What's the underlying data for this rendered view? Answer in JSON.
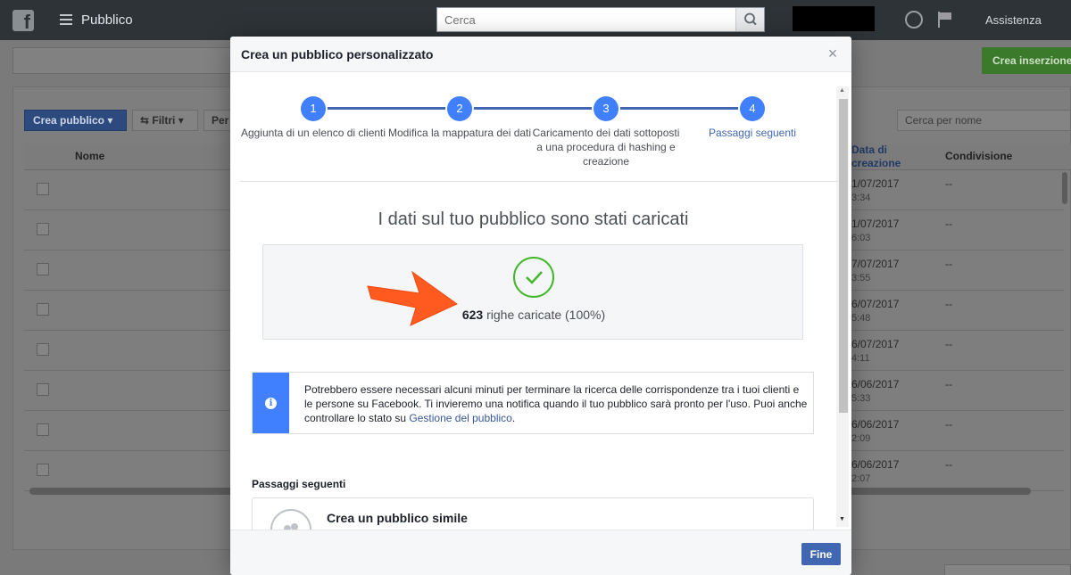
{
  "topbar": {
    "logo_letter": "f",
    "app_title": "Pubblico",
    "search_placeholder": "Cerca",
    "help_label": "Assistenza"
  },
  "background": {
    "create_ad_label": "Crea inserzione",
    "create_audience_label": "Crea pubblico",
    "filters_label": "Filtri",
    "per_label": "Per",
    "search_name_placeholder": "Cerca per nome",
    "columns": {
      "name": "Nome",
      "date": "Data di creazione",
      "sharing": "Condivisione"
    },
    "rows": [
      {
        "date": "1/07/2017",
        "time": "3:34",
        "sharing": "--"
      },
      {
        "date": "1/07/2017",
        "time": "6:03",
        "sharing": "--"
      },
      {
        "date": "7/07/2017",
        "time": "3:55",
        "sharing": "--"
      },
      {
        "date": "6/07/2017",
        "time": "5:48",
        "sharing": "--"
      },
      {
        "date": "6/07/2017",
        "time": "4:11",
        "sharing": "--"
      },
      {
        "date": "6/06/2017",
        "time": "5:33",
        "sharing": "--"
      },
      {
        "date": "6/06/2017",
        "time": "2:09",
        "sharing": "--"
      },
      {
        "date": "6/06/2017",
        "time": "2:07",
        "sharing": "--"
      }
    ]
  },
  "modal": {
    "title": "Crea un pubblico personalizzato",
    "close_symbol": "×",
    "steps": [
      {
        "number": "1",
        "label": "Aggiunta di un elenco di clienti"
      },
      {
        "number": "2",
        "label": "Modifica la mappatura dei dati"
      },
      {
        "number": "3",
        "label": "Caricamento dei dati sottoposti a una procedura di hashing e creazione"
      },
      {
        "number": "4",
        "label": "Passaggi seguenti"
      }
    ],
    "success_title": "I dati sul tuo pubblico sono stati caricati",
    "rows_count": "623",
    "rows_suffix": " righe caricate (100%)",
    "info_text": "Potrebbero essere necessari alcuni minuti per terminare la ricerca delle corrispondenze tra i tuoi clienti e le persone su Facebook. Ti invieremo una notifica quando il tuo pubblico sarà pronto per l'uso. Puoi anche controllare lo stato su ",
    "info_link": "Gestione del pubblico",
    "info_end": ".",
    "next_steps_title": "Passaggi seguenti",
    "next_card_label": "Crea un pubblico simile",
    "done_label": "Fine"
  },
  "colors": {
    "accent": "#4267b2",
    "step_blue": "#4080ff",
    "success_green": "#42b72a",
    "arrow_orange": "#ff5a1f"
  }
}
